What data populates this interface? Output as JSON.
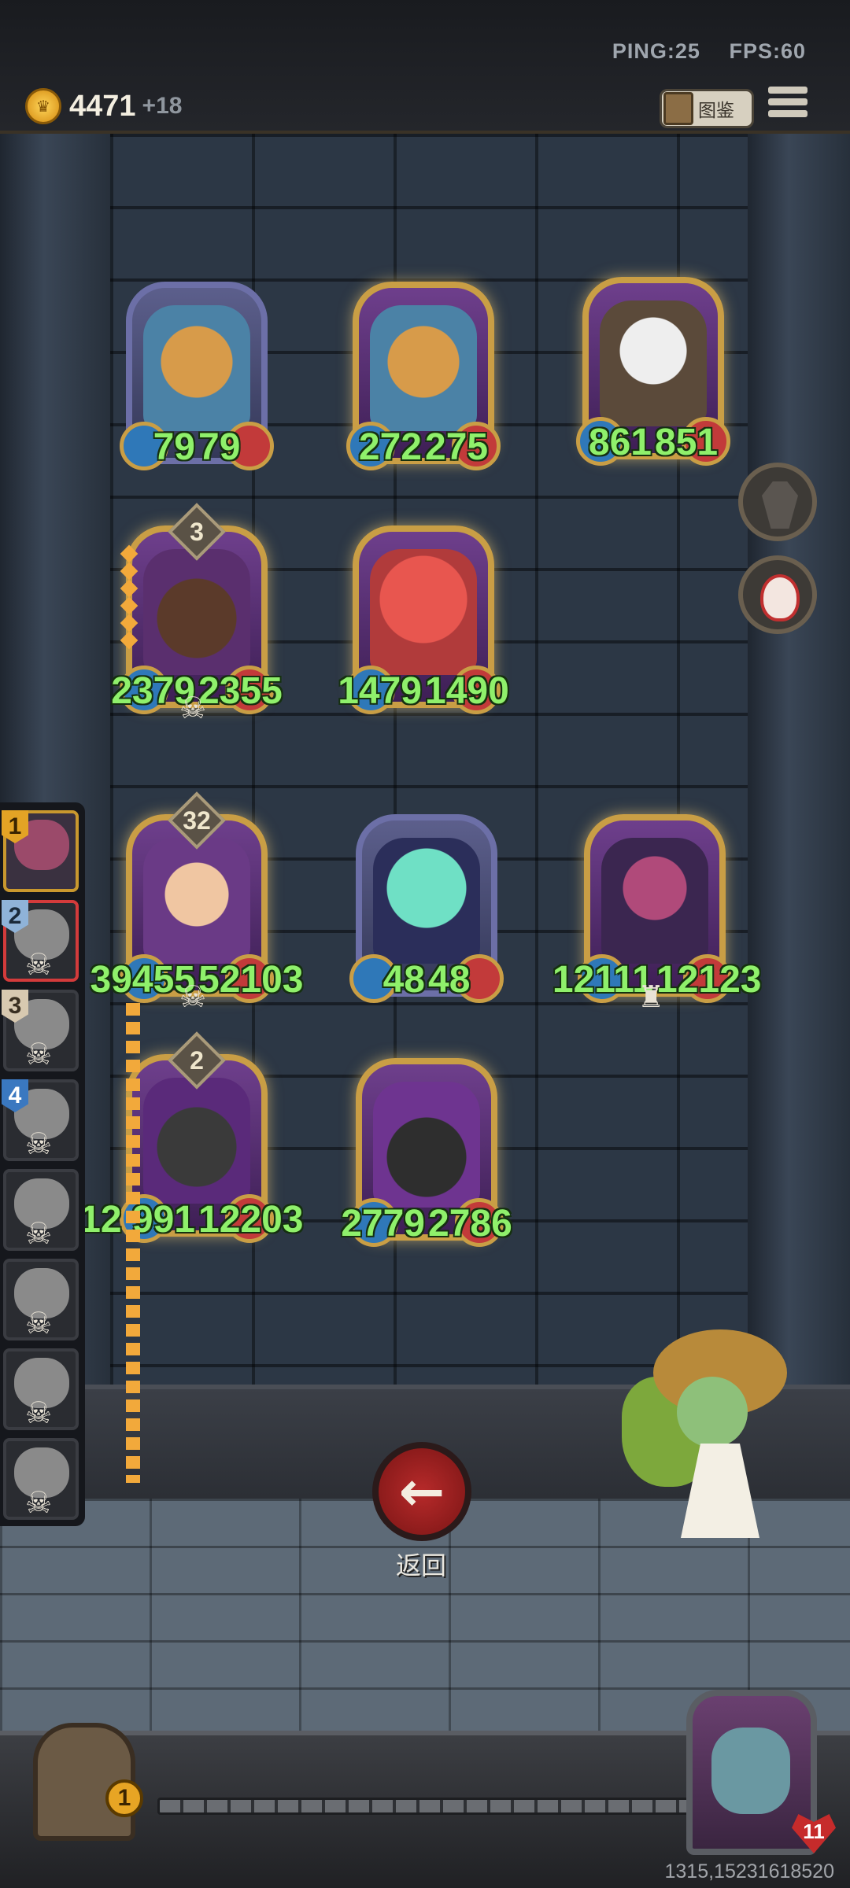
{
  "hud": {
    "ping_label": "PING:25",
    "fps_label": "FPS:60",
    "gold": "4471",
    "gold_income": "+18",
    "codex_label": "图鉴"
  },
  "board": {
    "cards": [
      {
        "name": "raccoon-card-1",
        "atk": "79",
        "hp": "79",
        "tier": "silver"
      },
      {
        "name": "raccoon-card-2",
        "atk": "272",
        "hp": "275",
        "tier": "gold"
      },
      {
        "name": "masked-rabbit-card",
        "atk": "861",
        "hp": "851",
        "tier": "gold"
      },
      {
        "name": "boar-card",
        "atk": "2379",
        "hp": "2355",
        "level": "3",
        "tier": "gold"
      },
      {
        "name": "octopus-card",
        "atk": "1479",
        "hp": "1490",
        "tier": "gold"
      },
      {
        "name": "old-scientist-card",
        "atk": "39455",
        "hp": "52103",
        "level": "32",
        "tier": "gold"
      },
      {
        "name": "ghost-card",
        "atk": "48",
        "hp": "48",
        "tier": "silver"
      },
      {
        "name": "pirate-card",
        "atk": "12111",
        "hp": "12123",
        "tier": "gold"
      },
      {
        "name": "knight-card",
        "atk": "12 991",
        "hp": "12203",
        "level": "2",
        "tier": "gold"
      },
      {
        "name": "chest-creature-card",
        "atk": "2779",
        "hp": "2786",
        "tier": "gold"
      }
    ]
  },
  "roster": {
    "slots": [
      {
        "rank": "1"
      },
      {
        "rank": "2"
      },
      {
        "rank": "3"
      },
      {
        "rank": "4"
      },
      {
        "rank": ""
      },
      {
        "rank": ""
      },
      {
        "rank": ""
      },
      {
        "rank": ""
      }
    ]
  },
  "actions": {
    "back_label": "返回"
  },
  "bottom": {
    "chest_count": "1",
    "hero_hp": "11",
    "player_id": "1315,15231618520"
  }
}
